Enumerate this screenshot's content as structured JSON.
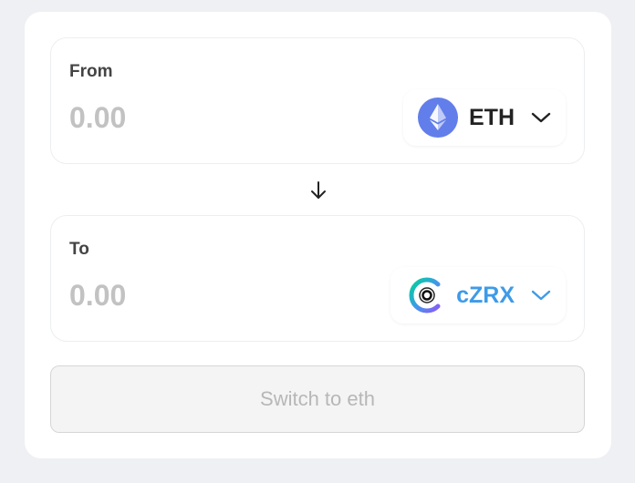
{
  "from": {
    "label": "From",
    "amount_placeholder": "0.00",
    "token": {
      "symbol": "ETH",
      "icon": "ethereum-icon",
      "color": "#222222",
      "icon_bg": "#627eea"
    }
  },
  "direction_icon": "arrow-down-icon",
  "to": {
    "label": "To",
    "amount_placeholder": "0.00",
    "token": {
      "symbol": "cZRX",
      "icon": "compound-zrx-icon",
      "color": "#3d9be9"
    }
  },
  "action": {
    "label": "Switch to eth",
    "disabled": true
  },
  "colors": {
    "page_bg": "#eff0f3",
    "card_bg": "#ffffff",
    "placeholder": "#c2c2c2",
    "accent": "#3d9be9"
  }
}
